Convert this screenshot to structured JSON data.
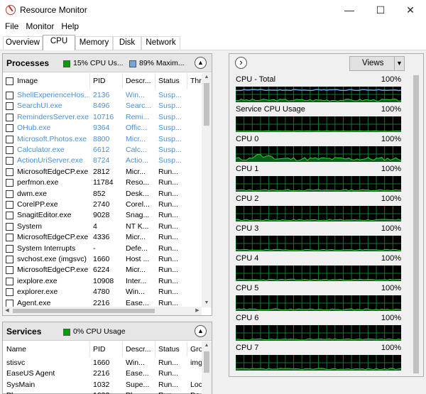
{
  "window": {
    "title": "Resource Monitor",
    "minimize": "—",
    "maximize": "☐",
    "close": "✕"
  },
  "menu": [
    "File",
    "Monitor",
    "Help"
  ],
  "tabs": [
    "Overview",
    "CPU",
    "Memory",
    "Disk",
    "Network"
  ],
  "active_tab": "CPU",
  "processes": {
    "title": "Processes",
    "cpu_usage_label": "15% CPU Us...",
    "max_freq_label": "89% Maxim...",
    "cpu_color": "#00a000",
    "freq_color": "#6fa8dc",
    "columns": [
      "Image",
      "PID",
      "Descr...",
      "Status",
      "Thr"
    ],
    "rows": [
      {
        "image": "ShellExperienceHos...",
        "pid": "2136",
        "desc": "Win...",
        "status": "Susp...",
        "suspended": true
      },
      {
        "image": "SearchUI.exe",
        "pid": "8496",
        "desc": "Searc...",
        "status": "Susp...",
        "suspended": true
      },
      {
        "image": "RemindersServer.exe",
        "pid": "10716",
        "desc": "Remi...",
        "status": "Susp...",
        "suspended": true
      },
      {
        "image": "OHub.exe",
        "pid": "9364",
        "desc": "Offic...",
        "status": "Susp...",
        "suspended": true
      },
      {
        "image": "Microsoft.Photos.exe",
        "pid": "8800",
        "desc": "Micr...",
        "status": "Susp...",
        "suspended": true
      },
      {
        "image": "Calculator.exe",
        "pid": "6612",
        "desc": "Calc...",
        "status": "Susp...",
        "suspended": true
      },
      {
        "image": "ActionUriServer.exe",
        "pid": "8724",
        "desc": "Actio...",
        "status": "Susp...",
        "suspended": true
      },
      {
        "image": "MicrosoftEdgeCP.exe",
        "pid": "2812",
        "desc": "Micr...",
        "status": "Run...",
        "suspended": false
      },
      {
        "image": "perfmon.exe",
        "pid": "11784",
        "desc": "Reso...",
        "status": "Run...",
        "suspended": false
      },
      {
        "image": "dwm.exe",
        "pid": "852",
        "desc": "Desk...",
        "status": "Run...",
        "suspended": false
      },
      {
        "image": "CorelPP.exe",
        "pid": "2740",
        "desc": "Corel...",
        "status": "Run...",
        "suspended": false
      },
      {
        "image": "SnagitEditor.exe",
        "pid": "9028",
        "desc": "Snag...",
        "status": "Run...",
        "suspended": false
      },
      {
        "image": "System",
        "pid": "4",
        "desc": "NT K...",
        "status": "Run...",
        "suspended": false
      },
      {
        "image": "MicrosoftEdgeCP.exe",
        "pid": "4336",
        "desc": "Micr...",
        "status": "Run...",
        "suspended": false
      },
      {
        "image": "System Interrupts",
        "pid": "-",
        "desc": "Defe...",
        "status": "Run...",
        "suspended": false
      },
      {
        "image": "svchost.exe (imgsvc)",
        "pid": "1660",
        "desc": "Host ...",
        "status": "Run...",
        "suspended": false
      },
      {
        "image": "MicrosoftEdgeCP.exe",
        "pid": "6224",
        "desc": "Micr...",
        "status": "Run...",
        "suspended": false
      },
      {
        "image": "iexplore.exe",
        "pid": "10908",
        "desc": "Inter...",
        "status": "Run...",
        "suspended": false
      },
      {
        "image": "explorer.exe",
        "pid": "4780",
        "desc": "Win...",
        "status": "Run...",
        "suspended": false
      },
      {
        "image": "Agent.exe",
        "pid": "2216",
        "desc": "Ease...",
        "status": "Run...",
        "suspended": false
      }
    ]
  },
  "services": {
    "title": "Services",
    "cpu_usage_label": "0% CPU Usage",
    "columns": [
      "Name",
      "PID",
      "Descr...",
      "Status",
      "Gro"
    ],
    "rows": [
      {
        "name": "stisvc",
        "pid": "1660",
        "desc": "Win...",
        "status": "Run...",
        "group": "img"
      },
      {
        "name": "EaseUS Agent",
        "pid": "2216",
        "desc": "Ease...",
        "status": "Run...",
        "group": ""
      },
      {
        "name": "SysMain",
        "pid": "1032",
        "desc": "Supe...",
        "status": "Run...",
        "group": "Loc"
      },
      {
        "name": "Pl...",
        "pid": "1032",
        "desc": "Pl...",
        "status": "Run...",
        "group": "Dc"
      }
    ]
  },
  "graphs": {
    "expand_icon": "›",
    "views_label": "Views",
    "items": [
      {
        "title": "CPU - Total",
        "max": "100%",
        "avg": 0.1,
        "seed": 3
      },
      {
        "title": "Service CPU Usage",
        "max": "100%",
        "avg": 0.02,
        "seed": 7
      },
      {
        "title": "CPU 0",
        "max": "100%",
        "avg": 0.16,
        "seed": 11
      },
      {
        "title": "CPU 1",
        "max": "100%",
        "avg": 0.06,
        "seed": 13
      },
      {
        "title": "CPU 2",
        "max": "100%",
        "avg": 0.06,
        "seed": 17
      },
      {
        "title": "CPU 3",
        "max": "100%",
        "avg": 0.05,
        "seed": 19
      },
      {
        "title": "CPU 4",
        "max": "100%",
        "avg": 0.05,
        "seed": 23
      },
      {
        "title": "CPU 5",
        "max": "100%",
        "avg": 0.06,
        "seed": 29
      },
      {
        "title": "CPU 6",
        "max": "100%",
        "avg": 0.05,
        "seed": 31
      },
      {
        "title": "CPU 7",
        "max": "100%",
        "avg": 0.06,
        "seed": 37
      }
    ]
  }
}
